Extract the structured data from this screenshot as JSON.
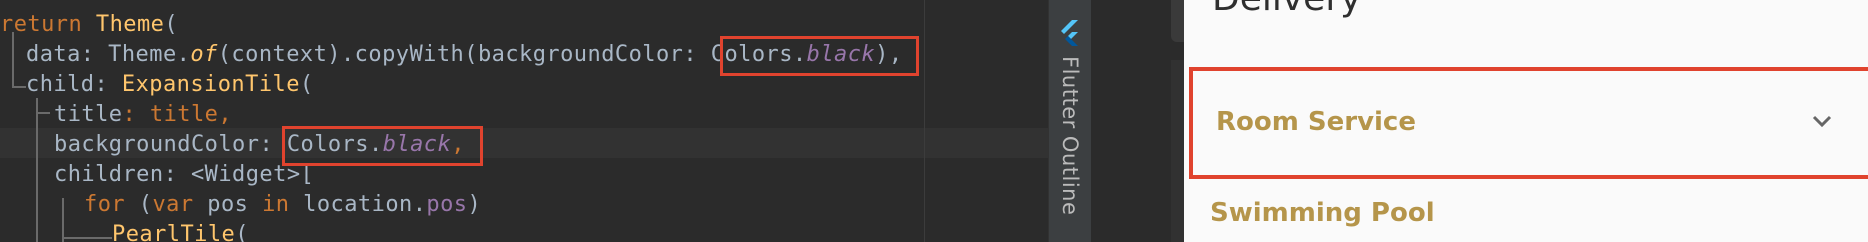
{
  "editor": {
    "lines": [
      {
        "id": "l1",
        "parts": [
          {
            "t": "return",
            "c": "kw"
          },
          {
            "t": " "
          },
          {
            "t": "Theme",
            "c": "cls"
          },
          {
            "t": "("
          }
        ]
      },
      {
        "id": "l2",
        "parts": [
          {
            "t": "data"
          },
          {
            "t": ": Theme."
          },
          {
            "t": "of",
            "c": "fn"
          },
          {
            "t": "(context).copyWith(backgroundColor: "
          },
          {
            "t": "Colors."
          },
          {
            "t": "black",
            "c": "prop"
          },
          {
            "t": "),"
          }
        ]
      },
      {
        "id": "l3",
        "parts": [
          {
            "t": "child"
          },
          {
            "t": ": "
          },
          {
            "t": "ExpansionTile",
            "c": "cls"
          },
          {
            "t": "("
          }
        ]
      },
      {
        "id": "l4",
        "parts": [
          {
            "t": "title"
          },
          {
            "t": ": title,",
            "c": "kwpart"
          }
        ]
      },
      {
        "id": "l5",
        "parts": [
          {
            "t": "backgroundColor"
          },
          {
            "t": ": "
          },
          {
            "t": "Colors."
          },
          {
            "t": "black",
            "c": "prop"
          },
          {
            "t": ","
          }
        ]
      },
      {
        "id": "l6",
        "parts": [
          {
            "t": "children"
          },
          {
            "t": ": <Widget>["
          }
        ]
      },
      {
        "id": "l7",
        "parts": [
          {
            "t": "for",
            "c": "kw"
          },
          {
            "t": " ("
          },
          {
            "t": "var",
            "c": "kw"
          },
          {
            "t": " pos "
          },
          {
            "t": "in",
            "c": "kw"
          },
          {
            "t": " location."
          },
          {
            "t": "pos",
            "c": "prop2"
          },
          {
            "t": ")"
          }
        ]
      },
      {
        "id": "l8",
        "parts": [
          {
            "t": "PearlTile",
            "c": "cls"
          },
          {
            "t": "("
          }
        ]
      }
    ]
  },
  "tool_window": {
    "label": "Flutter Outline",
    "icon": "flutter-logo-icon"
  },
  "app": {
    "section_title": "Delivery",
    "tiles": [
      {
        "label": "Room Service",
        "icon": "chevron-down-icon"
      },
      {
        "label": "Swimming Pool"
      }
    ]
  },
  "colors": {
    "highlight": "#e0432e",
    "tile_text": "#b5954a"
  }
}
